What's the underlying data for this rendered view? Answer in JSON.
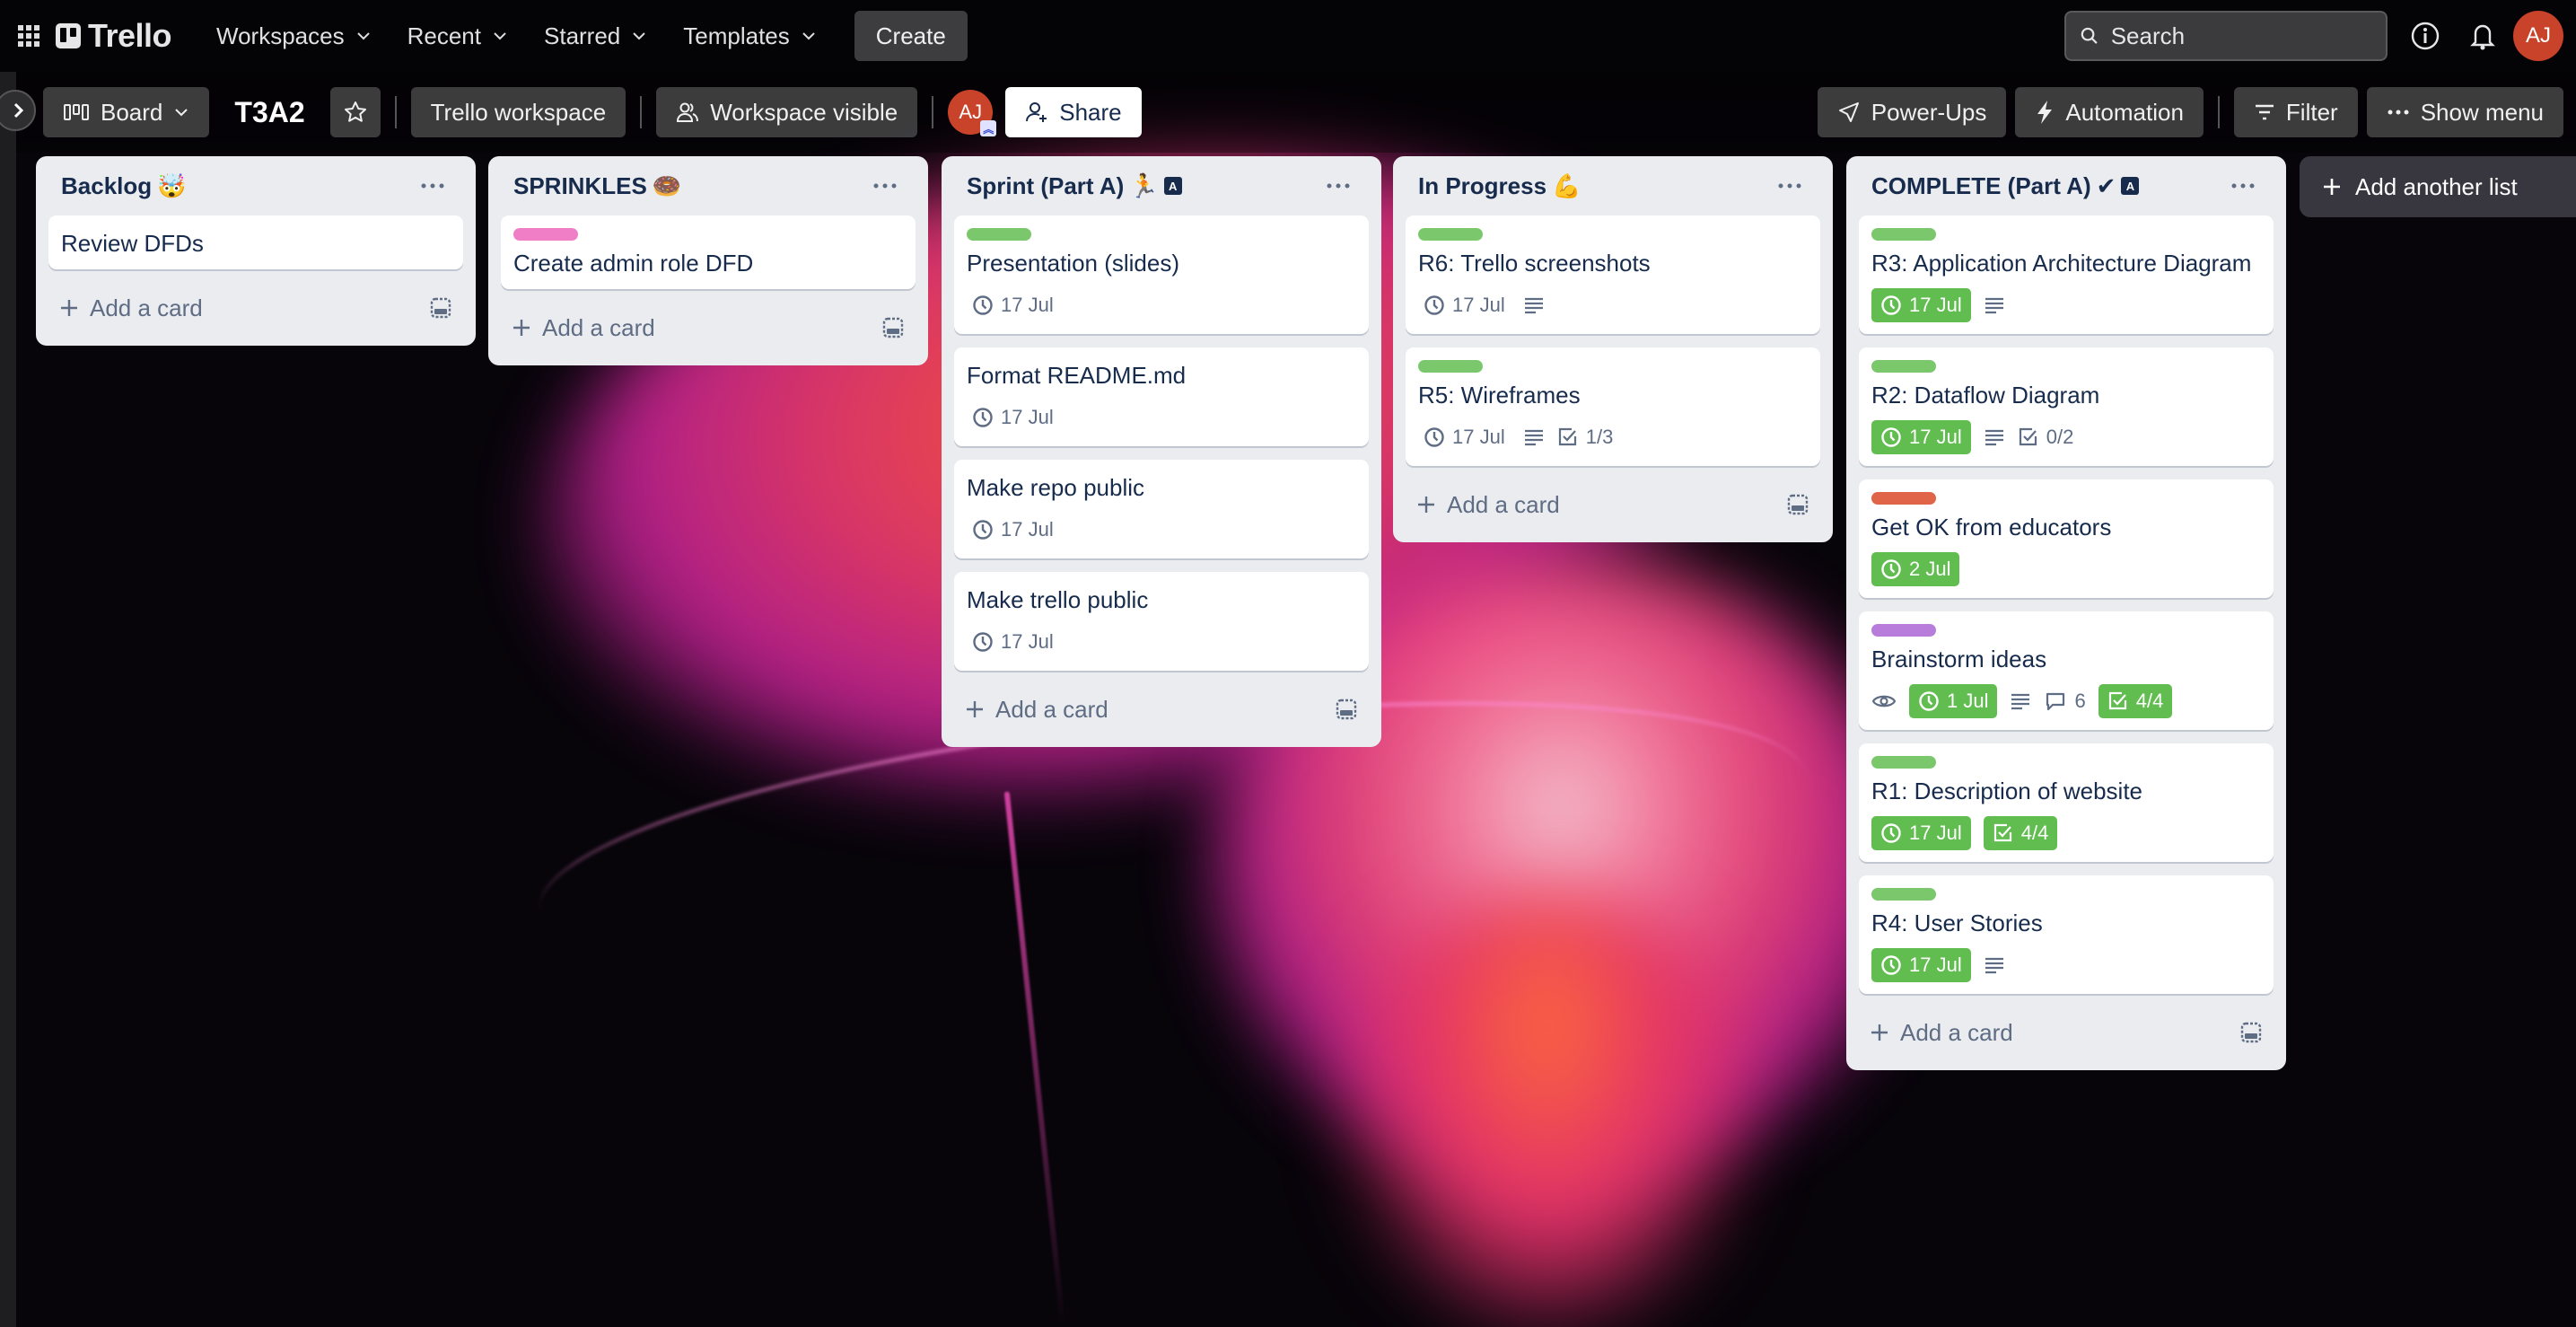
{
  "topnav": {
    "logo_text": "Trello",
    "menus": [
      {
        "label": "Workspaces"
      },
      {
        "label": "Recent"
      },
      {
        "label": "Starred"
      },
      {
        "label": "Templates"
      }
    ],
    "create_label": "Create",
    "search_placeholder": "Search",
    "avatar_initials": "AJ"
  },
  "board_header": {
    "view_label": "Board",
    "board_title": "T3A2",
    "workspace_label": "Trello workspace",
    "visibility_label": "Workspace visible",
    "member_initials": "AJ",
    "share_label": "Share",
    "powerups_label": "Power-Ups",
    "automation_label": "Automation",
    "filter_label": "Filter",
    "show_menu_label": "Show menu"
  },
  "label_colors": {
    "green": "#7bc86c",
    "pink": "#ef7ec6",
    "red": "#e06448",
    "purple": "#b87ddb",
    "done_green": "#61bd4f"
  },
  "lists": [
    {
      "title": "Backlog",
      "emoji": "🤯",
      "cards": [
        {
          "title": "Review DFDs"
        }
      ],
      "add_card_label": "Add a card"
    },
    {
      "title": "SPRINKLES",
      "emoji": "🍩",
      "cards": [
        {
          "label": "pink",
          "title": "Create admin role DFD"
        }
      ],
      "add_card_label": "Add a card"
    },
    {
      "title": "Sprint (Part A)",
      "emoji": "🏃",
      "tag": "A",
      "cards": [
        {
          "label": "green",
          "title": "Presentation (slides)",
          "due": "17 Jul"
        },
        {
          "title": "Format README.md",
          "due": "17 Jul"
        },
        {
          "title": "Make repo public",
          "due": "17 Jul"
        },
        {
          "title": "Make trello public",
          "due": "17 Jul"
        }
      ],
      "add_card_label": "Add a card"
    },
    {
      "title": "In Progress",
      "emoji": "💪",
      "cards": [
        {
          "label": "green",
          "title": "R6: Trello screenshots",
          "due": "17 Jul",
          "description": true
        },
        {
          "label": "green",
          "title": "R5: Wireframes",
          "due": "17 Jul",
          "description": true,
          "checklist": "1/3"
        }
      ],
      "add_card_label": "Add a card"
    },
    {
      "title": "COMPLETE (Part A)",
      "emoji": "✔",
      "tag": "A",
      "cards": [
        {
          "label": "green",
          "title": "R3: Application Architecture Diagram",
          "due": "17 Jul",
          "due_complete": true,
          "description": true
        },
        {
          "label": "green",
          "title": "R2: Dataflow Diagram",
          "due": "17 Jul",
          "due_complete": true,
          "description": true,
          "checklist": "0/2"
        },
        {
          "label": "red",
          "title": "Get OK from educators",
          "due": "2 Jul",
          "due_complete": true
        },
        {
          "label": "purple",
          "title": "Brainstorm ideas",
          "watching": true,
          "due": "1 Jul",
          "due_complete": true,
          "description": true,
          "comments": "6",
          "checklist": "4/4",
          "checklist_complete": true
        },
        {
          "label": "green",
          "title": "R1: Description of website",
          "due": "17 Jul",
          "due_complete": true,
          "checklist": "4/4",
          "checklist_complete": true
        },
        {
          "label": "green",
          "title": "R4: User Stories",
          "due": "17 Jul",
          "due_complete": true,
          "description": true
        }
      ],
      "add_card_label": "Add a card"
    }
  ],
  "add_list_label": "Add another list"
}
